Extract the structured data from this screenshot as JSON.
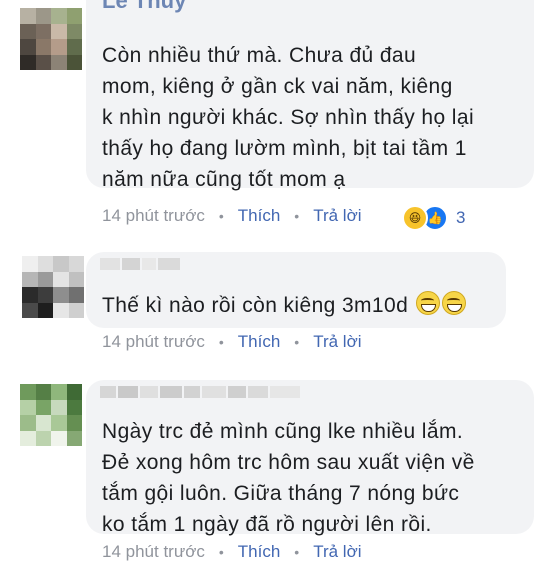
{
  "comments": [
    {
      "author_partial": "Le Thuy",
      "text_lines": [
        "Còn nhiều  thứ  mà. Chưa  đủ  đau",
        "mom,  kiêng  ở gần ck  vai năm,  kiêng",
        "k nhìn người  khác. Sợ nhìn thấy họ lại",
        "thấy họ đang lườm mình,  bịt tai  tầm 1",
        "năm nữa  cũng tốt mom ạ"
      ],
      "time": "14 phút trước",
      "like_label": "Thích",
      "reply_label": "Trả lời",
      "reactions": {
        "icons": [
          "haha-icon",
          "like-icon"
        ],
        "count": "3"
      }
    },
    {
      "text_lines": [
        "Thế kì nào rồi còn kiêng 3m10d"
      ],
      "emojis": [
        "grinning-face-icon",
        "grinning-face-icon"
      ],
      "time": "14 phút trước",
      "like_label": "Thích",
      "reply_label": "Trả lời"
    },
    {
      "text_lines": [
        "Ngày trc đẻ mình cũng lke nhiều lắm.",
        "Đẻ xong hôm trc hôm sau xuất viện về",
        "tắm gội luôn. Giữa tháng 7 nóng bức",
        "ko tắm 1 ngày đã rồ người lên rồi."
      ],
      "time": "14 phút trước",
      "like_label": "Thích",
      "reply_label": "Trả lời"
    }
  ],
  "colors": {
    "bubble": "#f2f3f5",
    "text": "#1c1e21",
    "meta": "#90949c",
    "link": "#4267b2"
  }
}
